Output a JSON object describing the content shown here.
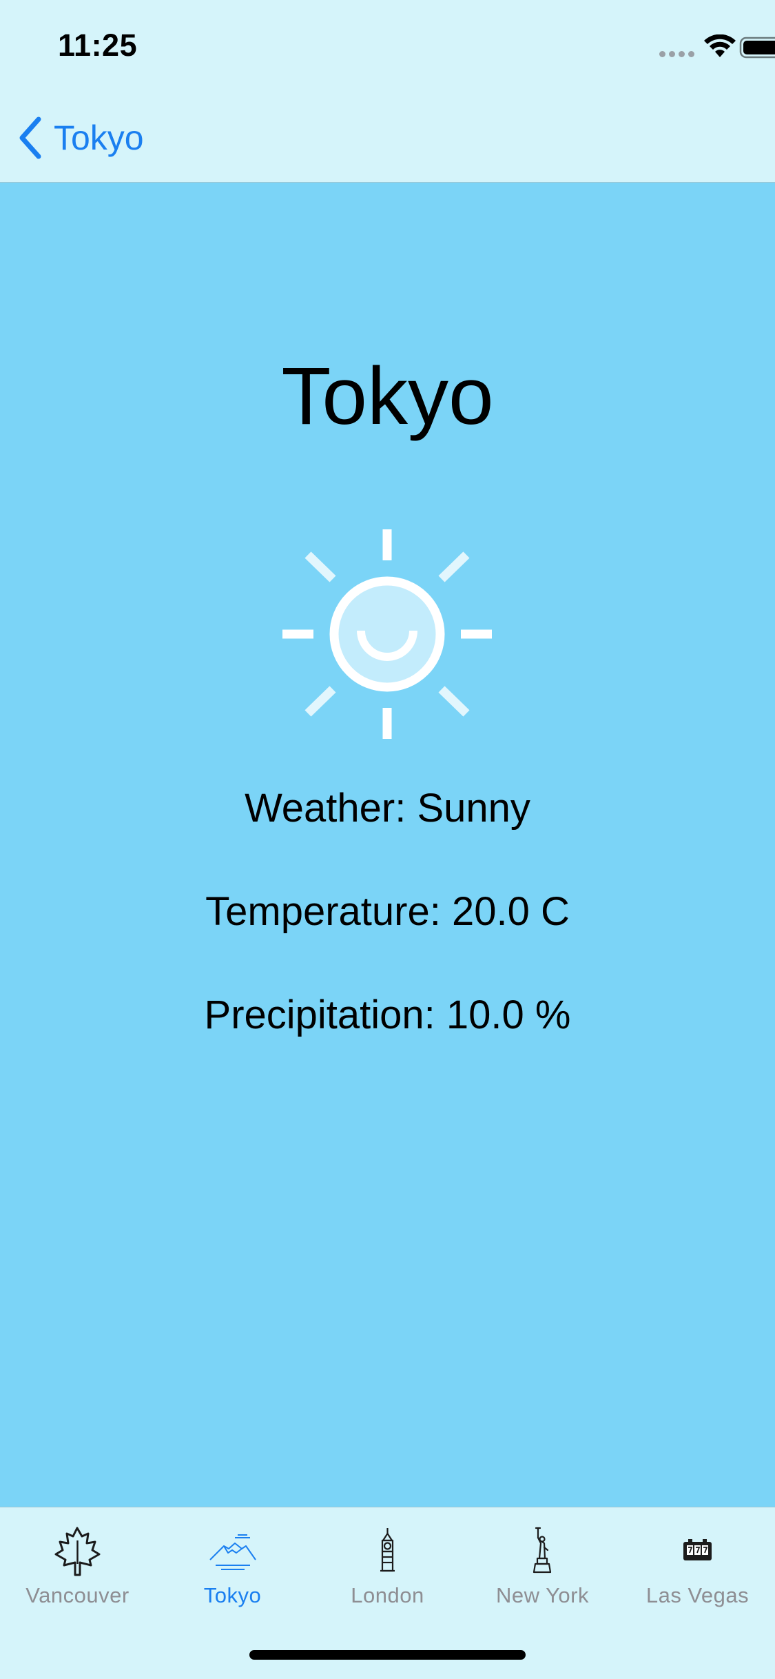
{
  "status_bar": {
    "time": "11:25",
    "icons": [
      "signal-dots-icon",
      "wifi-icon",
      "battery-icon"
    ]
  },
  "nav": {
    "back_label": "Tokyo",
    "accent_color": "#1a7ff0"
  },
  "city": {
    "name": "Tokyo",
    "weather_icon": "sun-icon",
    "weather_line": "Weather: Sunny",
    "temperature_line": "Temperature: 20.0 C",
    "precipitation_line": "Precipitation: 10.0 %"
  },
  "colors": {
    "background": "#7bd4f7",
    "bars": "#d5f4fa",
    "inactive_tab": "#8e8e93"
  },
  "tabs": [
    {
      "label": "Vancouver",
      "icon": "maple-leaf-icon",
      "active": false
    },
    {
      "label": "Tokyo",
      "icon": "mount-fuji-icon",
      "active": true
    },
    {
      "label": "London",
      "icon": "big-ben-icon",
      "active": false
    },
    {
      "label": "New York",
      "icon": "statue-of-liberty-icon",
      "active": false
    },
    {
      "label": "Las Vegas",
      "icon": "slot-machine-icon",
      "active": false
    }
  ]
}
